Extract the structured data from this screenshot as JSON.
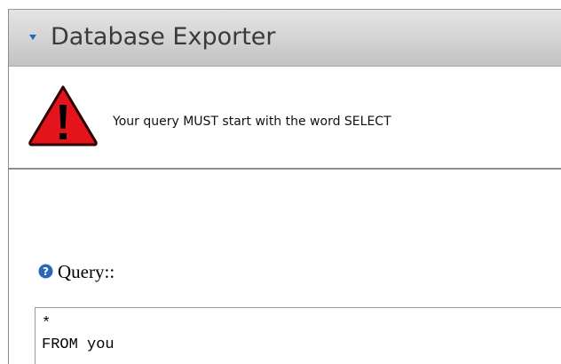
{
  "panel": {
    "title": "Database Exporter",
    "collapse_icon": "triangle-down-icon",
    "accent_color": "#1f66c9"
  },
  "alert": {
    "icon": "warning-icon",
    "icon_color": "#e4141c",
    "message": "Your query MUST start with the word SELECT"
  },
  "query": {
    "help_icon": "question-circle-icon",
    "label": "Query::",
    "value": "*\nFROM you"
  }
}
